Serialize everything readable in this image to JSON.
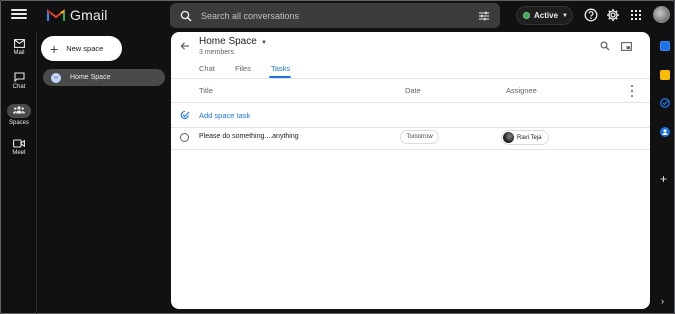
{
  "app": {
    "brand": "Gmail"
  },
  "search": {
    "placeholder": "Search all conversations"
  },
  "status": {
    "label": "Active",
    "color": "#34a853"
  },
  "rail": [
    {
      "label": "Mail"
    },
    {
      "label": "Chat"
    },
    {
      "label": "Spaces",
      "active": true
    },
    {
      "label": "Meet"
    }
  ],
  "sidebar": {
    "new_space_label": "New space",
    "spaces": [
      {
        "label": "Home Space",
        "avatar_initial": "H"
      }
    ]
  },
  "space": {
    "title": "Home Space",
    "members": "3 members",
    "tabs": [
      {
        "label": "Chat"
      },
      {
        "label": "Files"
      },
      {
        "label": "Tasks",
        "active": true
      }
    ]
  },
  "tasks": {
    "columns": {
      "title": "Title",
      "date": "Date",
      "assignee": "Assignee"
    },
    "add_label": "Add space task",
    "rows": [
      {
        "title": "Please do something....anything",
        "date": "Tomorrow",
        "assignee": "Ravi Teja"
      }
    ]
  },
  "colors": {
    "accent": "#1a73e8",
    "background": "#111111",
    "panel": "#ffffff"
  },
  "right_rail_icons": [
    "calendar-icon",
    "keep-icon",
    "tasks-icon",
    "contacts-icon"
  ]
}
